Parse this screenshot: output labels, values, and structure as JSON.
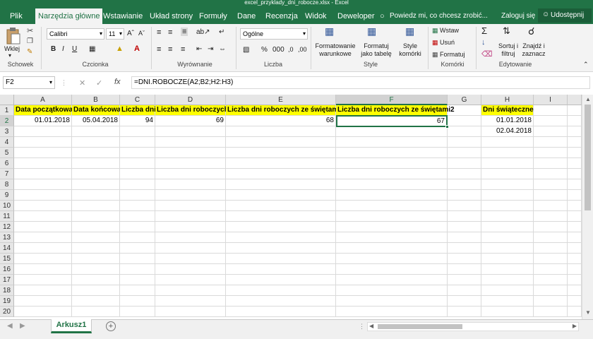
{
  "window": {
    "title": "excel_przyklady_dni_robocze.xlsx - Excel"
  },
  "menu": {
    "tabs": [
      "Plik",
      "Narzędzia główne",
      "Wstawianie",
      "Układ strony",
      "Formuły",
      "Dane",
      "Recenzja",
      "Widok",
      "Deweloper"
    ],
    "tell_me": "Powiedz mi, co chcesz zrobić...",
    "login": "Zaloguj się",
    "share": "Udostępnij"
  },
  "ribbon": {
    "paste_label": "Wklej",
    "font_name": "Calibri",
    "font_size": "11",
    "number_format": "Ogólne",
    "cond_format": "Formatowanie warunkowe",
    "format_table": "Formatuj jako tabelę",
    "cell_styles": "Style komórki",
    "insert": "Wstaw",
    "delete": "Usuń",
    "format": "Formatuj",
    "sort_filter": "Sortuj i filtruj",
    "find_select": "Znajdź i zaznacz",
    "groups": [
      "Schowek",
      "Czcionka",
      "Wyrównanie",
      "Liczba",
      "Style",
      "Komórki",
      "Edytowanie"
    ]
  },
  "formula_bar": {
    "name_box": "F2",
    "fx": "fx",
    "formula": "=DNI.ROBOCZE(A2;B2;H2:H3)"
  },
  "grid": {
    "columns": [
      "A",
      "B",
      "C",
      "D",
      "E",
      "F",
      "G",
      "H",
      "I"
    ],
    "rows": [
      "1",
      "2",
      "3",
      "4",
      "5",
      "6",
      "7",
      "8",
      "9",
      "10",
      "11",
      "12",
      "13",
      "14",
      "15",
      "16",
      "17",
      "18",
      "19",
      "20"
    ],
    "headers": {
      "A1": "Data początkowa",
      "B1": "Data końcowa",
      "C1": "Liczba dni",
      "D1": "Liczba dni roboczych",
      "E1": "Liczba dni roboczych ze świętami",
      "F1": "Liczba dni roboczych ze świętami2",
      "H1": "Dni świąteczne"
    },
    "values": {
      "A2": "01.01.2018",
      "B2": "05.04.2018",
      "C2": "94",
      "D2": "69",
      "E2": "68",
      "F2": "67",
      "H2": "01.01.2018",
      "H3": "02.04.2018"
    },
    "selected_cell": "F2"
  },
  "sheets": {
    "active": "Arkusz1",
    "add_label": "+"
  },
  "colors": {
    "accent": "#217346",
    "highlight": "#ffff00"
  }
}
